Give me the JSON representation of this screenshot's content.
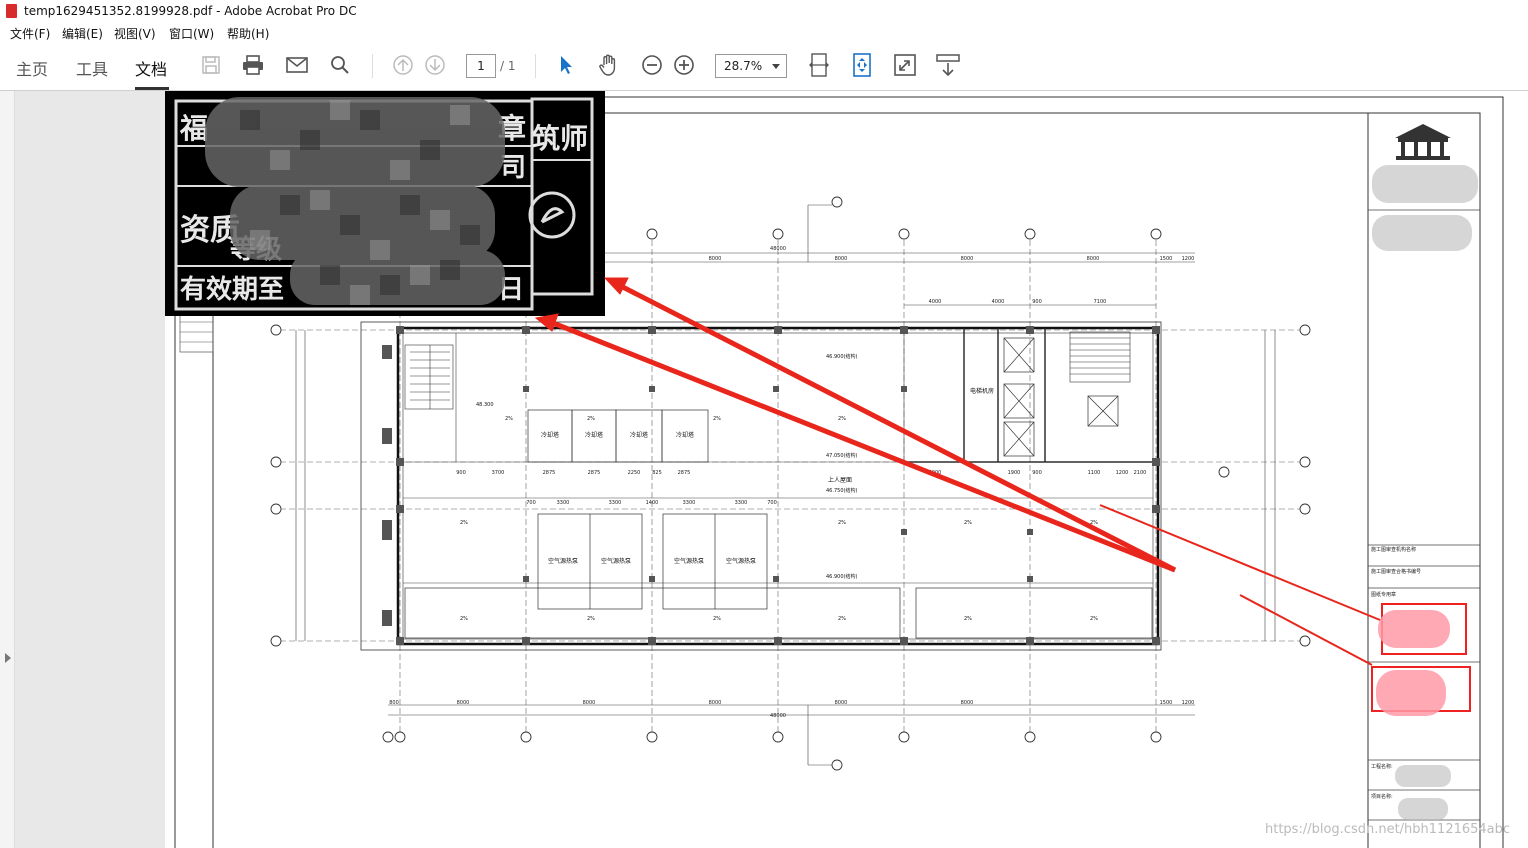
{
  "window": {
    "title": "temp1629451352.8199928.pdf - Adobe Acrobat Pro DC"
  },
  "menu": [
    "文件(F)",
    "编辑(E)",
    "视图(V)",
    "窗口(W)",
    "帮助(H)"
  ],
  "tabs": [
    "主页",
    "工具",
    "文档"
  ],
  "page_nav": {
    "current": "1",
    "total": "/ 1"
  },
  "zoom": "28.7%",
  "stamp": {
    "tl": "福",
    "tr": "章",
    "tr2": "筑师",
    "r2": "司",
    "zz": "资质",
    "dj": "等级",
    "yx": "有效期至",
    "ri": "日"
  },
  "plan": {
    "dims_top": [
      "48000",
      "8000",
      "8000",
      "8000",
      "8000",
      "1500",
      "1200"
    ],
    "dims_top2": [
      "4000",
      "4000",
      "900",
      "7100"
    ],
    "dims_bottom": [
      "48000",
      "800",
      "8000",
      "8000",
      "8000",
      "8000",
      "8000",
      "1500",
      "1200"
    ],
    "dims_mid": [
      "900",
      "3700",
      "2875",
      "2875",
      "2250",
      "825",
      "2875",
      "4000",
      "1900",
      "900",
      "1100",
      "1200",
      "2100"
    ],
    "dims_mid2": [
      "700",
      "3300",
      "3300",
      "1400",
      "3300",
      "3300",
      "700"
    ],
    "rooms": [
      "冷却塔",
      "冷却塔",
      "冷却塔",
      "冷却塔",
      "空气源热泵",
      "空气源热泵",
      "空气源热泵",
      "空气源热泵",
      "电梯机房",
      "上人屋面"
    ],
    "elev": [
      "46.900(结构)",
      "47.050(结构)",
      "46.750(结构)",
      "46.900(结构)",
      "48.300"
    ],
    "slope": "2%"
  },
  "title_block": {
    "r1": "施工图审查机构名称",
    "r2": "施工图审查合格书编号",
    "r3": "图纸专用章",
    "r4": "工程名称:",
    "r5": "项目名称:"
  },
  "watermark": "https://blog.csdn.net/hbh1121654abc",
  "colors": {
    "arrow": "#e8261c",
    "stamp_red": "#e22",
    "pdf_red": "#d82b2b"
  }
}
